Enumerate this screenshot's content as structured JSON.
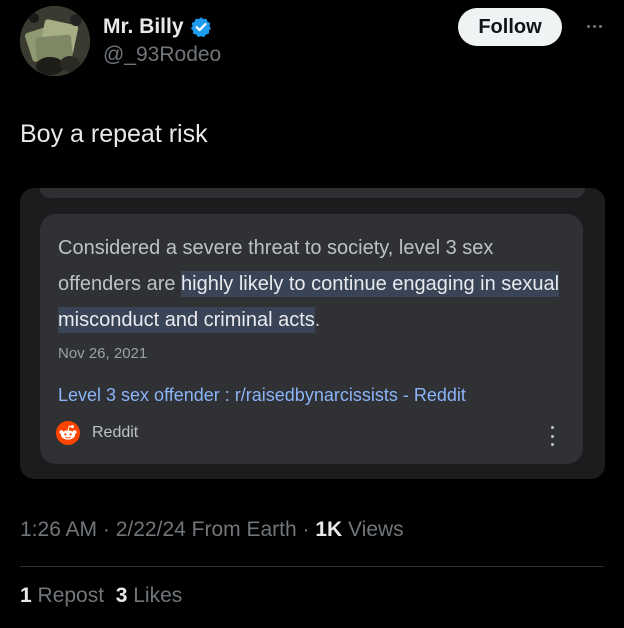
{
  "author": {
    "display_name": "Mr. Billy",
    "handle": "@_93Rodeo",
    "verified": true,
    "verified_color": "#1d9bf0"
  },
  "actions": {
    "follow_label": "Follow",
    "more_icon": "more-horizontal-icon"
  },
  "tweet": {
    "text": "Boy a repeat risk"
  },
  "screenshot_card": {
    "snippet_plain_1": "Considered a severe threat to society, level 3 sex offenders are ",
    "snippet_highlight": "highly likely to continue engaging in sexual misconduct and criminal acts",
    "snippet_plain_2": ".",
    "date": "Nov 26, 2021",
    "result_title": "Level 3 sex offender : r/raisedbynarcissists - Reddit",
    "source_name": "Reddit",
    "source_icon": "reddit-icon",
    "highlight_color": "#394457",
    "link_color": "#8ab4f8"
  },
  "meta": {
    "time": "1:26 AM",
    "sep1": " · ",
    "date": "2/22/24",
    "from": " From Earth",
    "sep2": " · ",
    "views_count": "1K",
    "views_label": " Views"
  },
  "engagement": {
    "reposts_count": "1",
    "reposts_label": " Repost",
    "likes_count": "3",
    "likes_label": " Likes"
  }
}
